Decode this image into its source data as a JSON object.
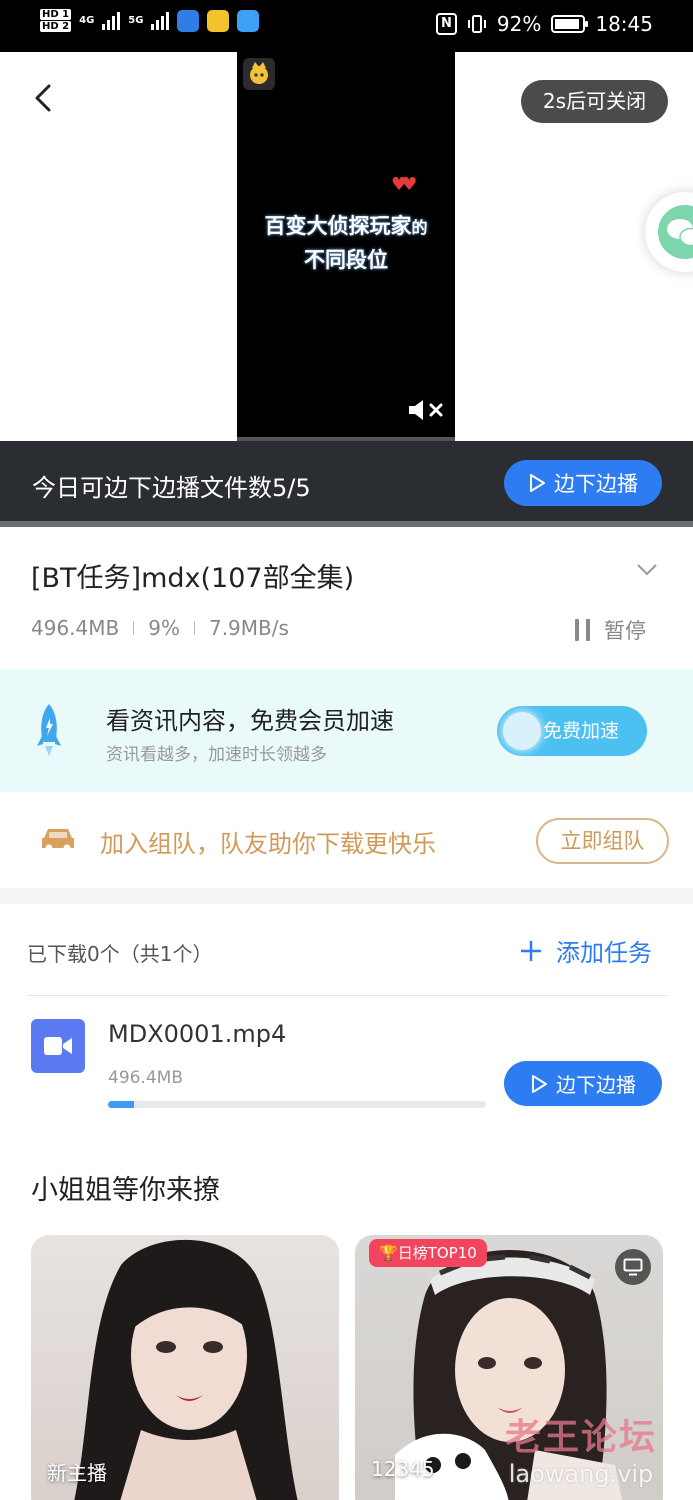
{
  "status_bar": {
    "network": "4G",
    "network2": "5G",
    "battery": "92%",
    "time": "18:45",
    "nfc": "N"
  },
  "ad": {
    "close_label": "2s后可关闭",
    "video_text_line1": "百变大侦探玩家",
    "video_text_suffix": "的",
    "video_text_line2": "不同段位"
  },
  "promo_bar": {
    "text": "今日可边下边播文件数5/5",
    "button_label": "边下边播"
  },
  "task": {
    "title": "[BT任务]mdx(107部全集)",
    "size": "496.4MB",
    "percent": "9%",
    "speed": "7.9MB/s",
    "pause_label": "暂停"
  },
  "accelerate": {
    "title": "看资讯内容，免费会员加速",
    "subtitle": "资讯看越多，加速时长领越多",
    "button_label": "免费加速"
  },
  "team": {
    "text": "加入组队，队友助你下载更快乐",
    "button_label": "立即组队"
  },
  "files": {
    "count_label": "已下载0个（共1个）",
    "add_task_label": "添加任务",
    "items": [
      {
        "name": "MDX0001.mp4",
        "size": "496.4MB",
        "progress": 0.07,
        "button_label": "边下边播"
      }
    ]
  },
  "recommend": {
    "title": "小姐姐等你来撩",
    "cards": [
      {
        "label": "新主播",
        "badge": ""
      },
      {
        "label": "12345",
        "badge": "日榜TOP10"
      }
    ]
  },
  "watermark": {
    "line1": "老王论坛",
    "line2": "laowang.vip"
  },
  "colors": {
    "primary": "#2d7cf2",
    "dark_bar": "#2a2d31",
    "accent_gold": "#d09a5a",
    "accel_bg": "#eafafa",
    "accel_button": "#4cc1f1"
  }
}
